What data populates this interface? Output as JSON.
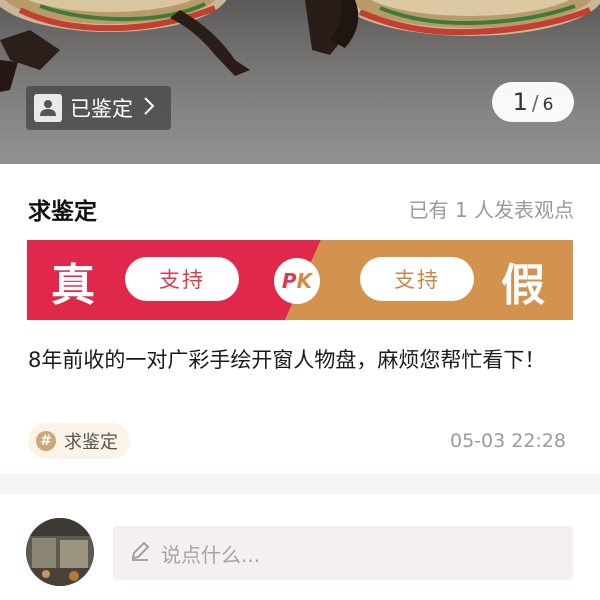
{
  "photo": {
    "verified_badge": "已鉴定",
    "page_current": "1",
    "page_separator": "/",
    "page_total": "6"
  },
  "post": {
    "title": "求鉴定",
    "opinions_summary": "已有 1 人发表观点",
    "description": "8年前收的一对广彩手绘开窗人物盘，麻烦您帮忙看下！",
    "tag": "求鉴定",
    "timestamp": "05-03 22:28"
  },
  "vote": {
    "real_label": "真",
    "fake_label": "假",
    "support_real": "支持",
    "support_fake": "支持",
    "pk_left": "P",
    "pk_right": "K",
    "real_color": "#e0284a",
    "fake_color": "#d4924f"
  },
  "comment": {
    "placeholder": "说点什么..."
  },
  "icons": {
    "badge": "verified-person-icon",
    "chevron": "chevron-right-icon",
    "tag": "hash-icon",
    "input": "pencil-icon"
  }
}
